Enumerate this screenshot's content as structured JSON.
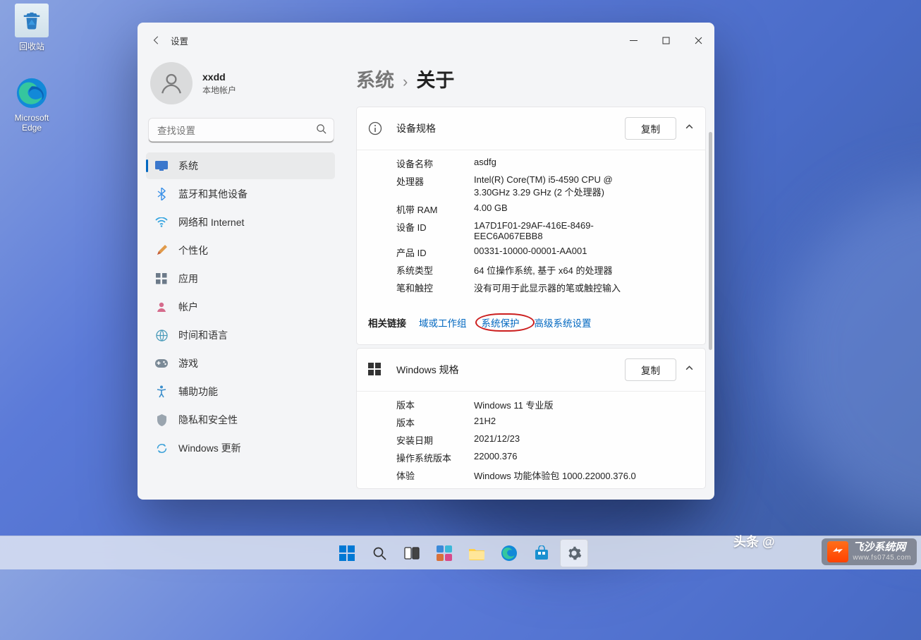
{
  "desktop": {
    "recycle_bin": "回收站",
    "edge": "Microsoft Edge"
  },
  "settings": {
    "title": "设置",
    "profile": {
      "name": "xxdd",
      "account": "本地帐户"
    },
    "search_placeholder": "查找设置",
    "nav": [
      {
        "label": "系统"
      },
      {
        "label": "蓝牙和其他设备"
      },
      {
        "label": "网络和 Internet"
      },
      {
        "label": "个性化"
      },
      {
        "label": "应用"
      },
      {
        "label": "帐户"
      },
      {
        "label": "时间和语言"
      },
      {
        "label": "游戏"
      },
      {
        "label": "辅助功能"
      },
      {
        "label": "隐私和安全性"
      },
      {
        "label": "Windows 更新"
      }
    ],
    "breadcrumb": {
      "root": "系统",
      "sep": "›",
      "current": "关于"
    },
    "device_specs": {
      "title": "设备规格",
      "copy": "复制",
      "rows": [
        {
          "k": "设备名称",
          "v": "asdfg"
        },
        {
          "k": "处理器",
          "v": "Intel(R) Core(TM) i5-4590 CPU @ 3.30GHz   3.29 GHz  (2 个处理器)"
        },
        {
          "k": "机带 RAM",
          "v": "4.00 GB"
        },
        {
          "k": "设备 ID",
          "v": "1A7D1F01-29AF-416E-8469-EEC6A067EBB8"
        },
        {
          "k": "产品 ID",
          "v": "00331-10000-00001-AA001"
        },
        {
          "k": "系统类型",
          "v": "64 位操作系统, 基于 x64 的处理器"
        },
        {
          "k": "笔和触控",
          "v": "没有可用于此显示器的笔或触控输入"
        }
      ]
    },
    "related": {
      "title": "相关链接",
      "links": [
        "域或工作组",
        "系统保护",
        "高级系统设置"
      ]
    },
    "windows_specs": {
      "title": "Windows 规格",
      "copy": "复制",
      "rows": [
        {
          "k": "版本",
          "v": "Windows 11 专业版"
        },
        {
          "k": "版本",
          "v": "21H2"
        },
        {
          "k": "安装日期",
          "v": "2021/12/23"
        },
        {
          "k": "操作系统版本",
          "v": "22000.376"
        },
        {
          "k": "体验",
          "v": "Windows 功能体验包 1000.22000.376.0"
        }
      ]
    }
  },
  "watermark": {
    "top": "头条 @",
    "brand": "飞沙系统网",
    "url": "www.fs0745.com"
  }
}
